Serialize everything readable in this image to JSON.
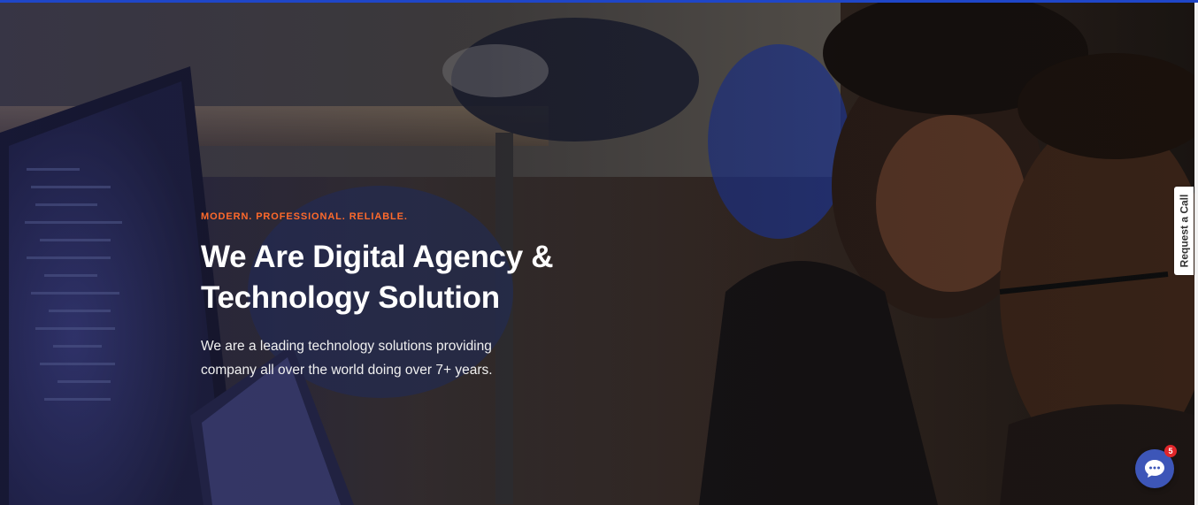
{
  "hero": {
    "tagline": "MODERN. PROFESSIONAL. RELIABLE.",
    "title_line1": "We Are Digital Agency &",
    "title_line2": "Technology Solution",
    "desc_line1": "We are a leading technology solutions providing",
    "desc_line2": "company all over the world doing over 7+ years."
  },
  "widgets": {
    "request_call_label": "Request a Call",
    "chat_badge_count": "5"
  },
  "colors": {
    "accent": "#ff6a2b",
    "top_bar": "#1f46c8",
    "chat_button": "#3d56b8",
    "badge": "#e0262a"
  },
  "icons": {
    "chat": "chat-bubble-icon"
  }
}
